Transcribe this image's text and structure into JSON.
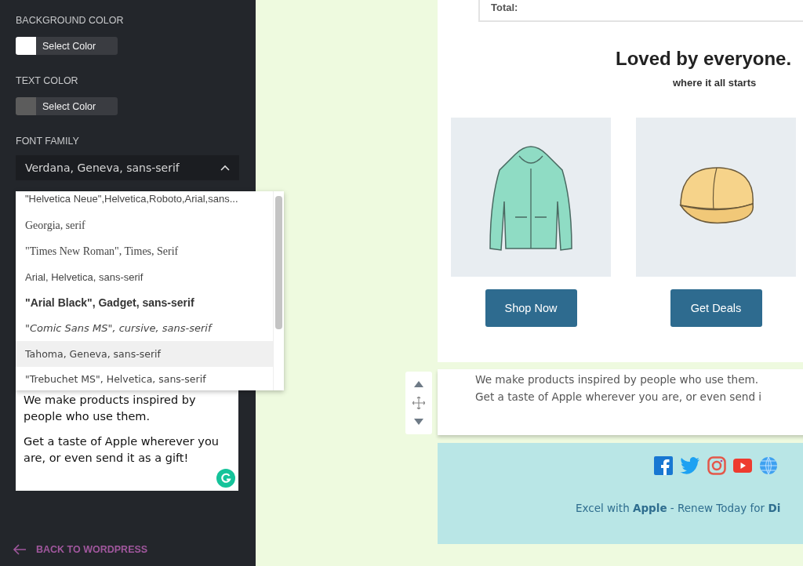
{
  "sidebar": {
    "color_settings": [
      {
        "label": "BACKGROUND COLOR",
        "color": "#ffffff",
        "button": "Select Color"
      },
      {
        "label": "TEXT COLOR",
        "color": "#5c5c5c",
        "button": "Select Color"
      }
    ],
    "font_family": {
      "label": "FONT FAMILY",
      "value": "Verdana, Geneva, sans-serif",
      "expanded": true,
      "options": [
        {
          "label": "\"Helvetica Neue\",Helvetica,Roboto,Arial,sans...",
          "kind": "sans",
          "highlighted": false
        },
        {
          "label": "Georgia, serif",
          "kind": "serif",
          "highlighted": false
        },
        {
          "label": "\"Times New Roman\", Times, Serif",
          "kind": "serif",
          "highlighted": false
        },
        {
          "label": "Arial, Helvetica, sans-serif",
          "kind": "sans",
          "highlighted": false
        },
        {
          "label": "\"Arial Black\", Gadget, sans-serif",
          "kind": "heavy",
          "highlighted": false
        },
        {
          "label": "\"Comic Sans MS\", cursive, sans-serif",
          "kind": "cursive",
          "highlighted": false
        },
        {
          "label": "Tahoma, Geneva, sans-serif",
          "kind": "wide",
          "highlighted": true
        },
        {
          "label": "\"Trebuchet MS\", Helvetica, sans-serif",
          "kind": "wide",
          "highlighted": false
        }
      ]
    },
    "text_content": [
      "We make products inspired by people who use them.",
      "Get a taste of Apple wherever you are, or even send it as a gift!"
    ],
    "back_link": "BACK TO WORDPRESS"
  },
  "email": {
    "total_label": "Total:",
    "heading": "Loved by everyone.",
    "subheading": "where it all starts",
    "products": [
      {
        "kind": "hoodie",
        "button": "Shop Now"
      },
      {
        "kind": "cap",
        "button": "Get Deals"
      }
    ],
    "text_block": [
      "We make products inspired by people who use them.",
      "Get a taste of Apple wherever you are, or even send i"
    ],
    "footer_text": "Excel with **Apple** - Renew Today for **Di**"
  }
}
